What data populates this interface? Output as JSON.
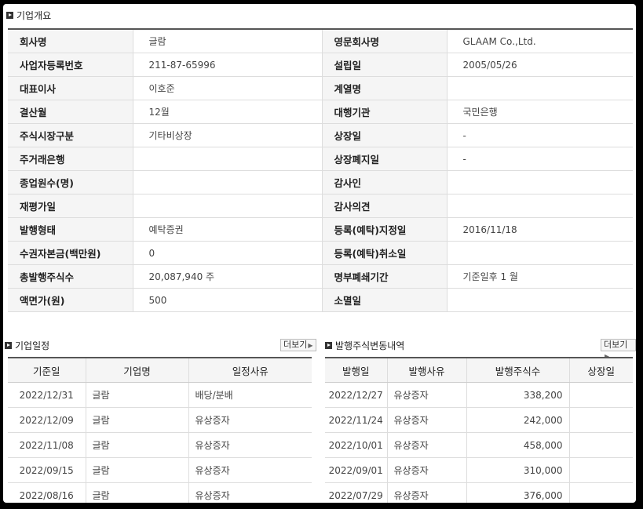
{
  "overview": {
    "title": "기업개요",
    "rows": [
      [
        "회사명",
        "글람",
        "영문회사명",
        "GLAAM Co.,Ltd."
      ],
      [
        "사업자등록번호",
        "211-87-65996",
        "설립일",
        "2005/05/26"
      ],
      [
        "대표이사",
        "이호준",
        "계열명",
        ""
      ],
      [
        "결산월",
        "12월",
        "대행기관",
        "국민은행"
      ],
      [
        "주식시장구분",
        "기타비상장",
        "상장일",
        "-"
      ],
      [
        "주거래은행",
        "",
        "상장폐지일",
        "-"
      ],
      [
        "종업원수(명)",
        "",
        "감사인",
        ""
      ],
      [
        "재평가일",
        "",
        "감사의견",
        ""
      ],
      [
        "발행형태",
        "예탁증권",
        "등록(예탁)지정일",
        "2016/11/18"
      ],
      [
        "수권자본금(백만원)",
        "0",
        "등록(예탁)취소일",
        ""
      ],
      [
        "총발행주식수",
        "20,087,940 주",
        "명부폐쇄기간",
        "기준일후 1 월"
      ],
      [
        "액면가(원)",
        "500",
        "소멸일",
        ""
      ]
    ]
  },
  "schedule": {
    "title": "기업일정",
    "more_label": "더보기",
    "headers": [
      "기준일",
      "기업명",
      "일정사유"
    ],
    "rows": [
      [
        "2022/12/31",
        "글람",
        "배당/분배"
      ],
      [
        "2022/12/09",
        "글람",
        "유상증자"
      ],
      [
        "2022/11/08",
        "글람",
        "유상증자"
      ],
      [
        "2022/09/15",
        "글람",
        "유상증자"
      ],
      [
        "2022/08/16",
        "글람",
        "유상증자"
      ]
    ]
  },
  "issuance": {
    "title": "발행주식변동내역",
    "more_label": "더보기",
    "headers": [
      "발행일",
      "발행사유",
      "발행주식수",
      "상장일"
    ],
    "rows": [
      [
        "2022/12/27",
        "유상증자",
        "338,200",
        ""
      ],
      [
        "2022/11/24",
        "유상증자",
        "242,000",
        ""
      ],
      [
        "2022/10/01",
        "유상증자",
        "458,000",
        ""
      ],
      [
        "2022/09/01",
        "유상증자",
        "310,000",
        ""
      ],
      [
        "2022/07/29",
        "유상증자",
        "376,000",
        ""
      ]
    ]
  }
}
